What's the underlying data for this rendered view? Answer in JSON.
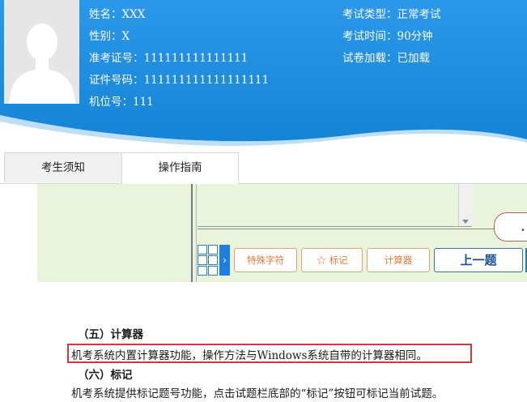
{
  "candidate": {
    "name": "姓名：XXX",
    "gender": "性别：X",
    "admission_no": "准考证号：111111111111111",
    "id_no": "证件号码：111111111111111111",
    "seat_no": "机位号：111"
  },
  "exam": {
    "type": "考试类型：正常考试",
    "time": "考试时间：90分钟",
    "paper_status": "试卷加载：已加载"
  },
  "tabs": [
    {
      "label": "考生须知"
    },
    {
      "label": "操作指南"
    }
  ],
  "guide_toolbar": {
    "special_chars": "特殊字符",
    "mark": "标记",
    "calculator": "计算器",
    "prev": "上一题"
  },
  "doc": {
    "heading_calculator": "（五）计算器",
    "para_calculator": "机考系统内置计算器功能，操作方法与Windows系统自带的计算器相同。",
    "heading_mark": "（六）标记",
    "para_mark": "机考系统提供标记题号功能，点击试题栏底部的“标记”按钮可标记当前试题。"
  },
  "colors": {
    "header_blue": "#1e8ee0",
    "highlight_red": "#d23a3a",
    "button_orange": "#e07a3a"
  }
}
